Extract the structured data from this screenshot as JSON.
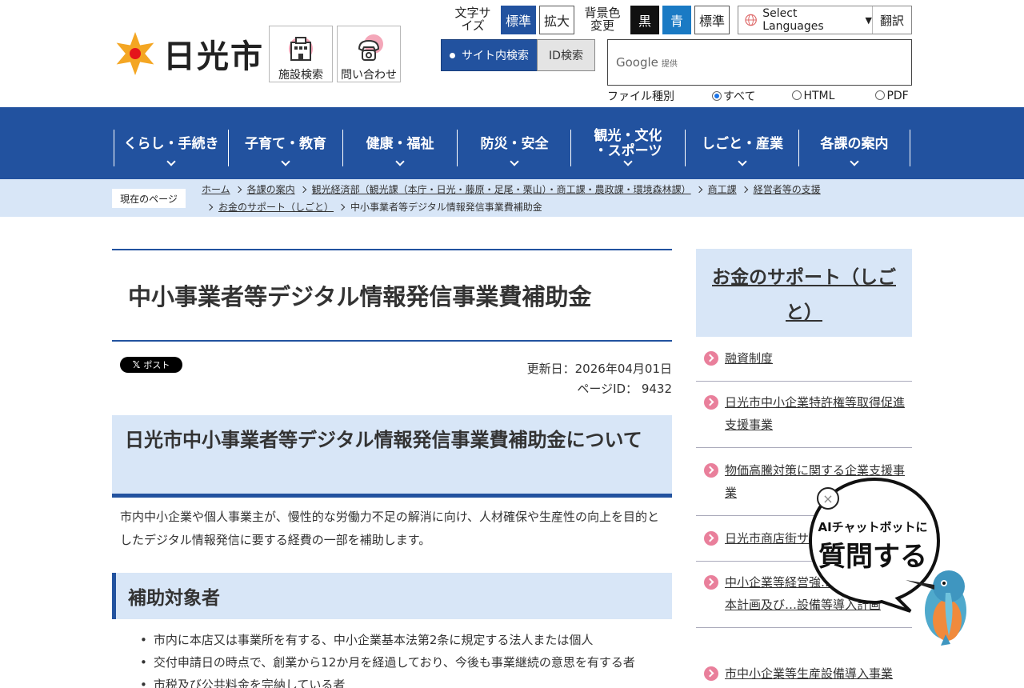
{
  "header": {
    "logo_text": "日光市",
    "facility_search": "施設検索",
    "contact": "問い合わせ",
    "font_size_label": "文字サイズ",
    "font_standard": "標準",
    "font_large": "拡大",
    "bg_label": "背景色変更",
    "bg_black": "黒",
    "bg_blue": "青",
    "bg_standard": "標準",
    "language_select": "Select Languages",
    "translate": "翻訳",
    "search_tab_site": "サイト内検索",
    "search_tab_id": "ID検索",
    "google_label": "Google",
    "google_provided": "提供",
    "filetype_label": "ファイル種別",
    "filetype_options": [
      "すべて",
      "HTML",
      "PDF"
    ],
    "filetype_selected": "すべて"
  },
  "nav": {
    "items": [
      "くらし・手続き",
      "子育て・教育",
      "健康・福祉",
      "防災・安全",
      "観光・文化\n・スポーツ",
      "しごと・産業",
      "各課の案内"
    ]
  },
  "breadcrumb": {
    "here_label": "現在のページ",
    "items": [
      "ホーム",
      "各課の案内",
      "観光経済部（観光課（本庁・日光・藤原・足尾・栗山）・商工課・農政課・環境森林課）",
      "商工課",
      "経営者等の支援",
      "お金のサポート（しごと）",
      "中小事業者等デジタル情報発信事業費補助金"
    ]
  },
  "main": {
    "title": "中小事業者等デジタル情報発信事業費補助金",
    "post_button": "ポスト",
    "updated": "更新日：2026年04月01日",
    "page_id": "ページID： 9432",
    "h2": "日光市中小事業者等デジタル情報発信事業費補助金について",
    "intro": "市内中小企業や個人事業主が、慢性的な労働力不足の解消に向け、人材確保や生産性の向上を目的としたデジタル情報発信に要する経費の一部を補助します。",
    "h3": "補助対象者",
    "bullets": [
      "市内に本店又は事業所を有する、中小企業基本法第2条に規定する法人または個人",
      "交付申請日の時点で、創業から12か月を経過しており、今後も事業継続の意思を有する者",
      "市税及び公共料金を完納している者"
    ]
  },
  "sidebar": {
    "title": "お金のサポート（しごと）",
    "items": [
      "融資制度",
      "日光市中小企業特許権等取得促進支援事業",
      "物価高騰対策に関する企業支援事業",
      "日光市商店街サ…",
      "中小企業等経営強…く導入促進基本計画及び…設備等導入計画",
      "市中小企業等生産設備導入事業"
    ]
  },
  "chatbot": {
    "line1": "AIチャットボットに",
    "line2": "質問する",
    "close": "×"
  },
  "colors": {
    "brand_blue": "#22529f",
    "light_blue": "#d8e6f7",
    "accent_pink": "#e97f9b"
  }
}
